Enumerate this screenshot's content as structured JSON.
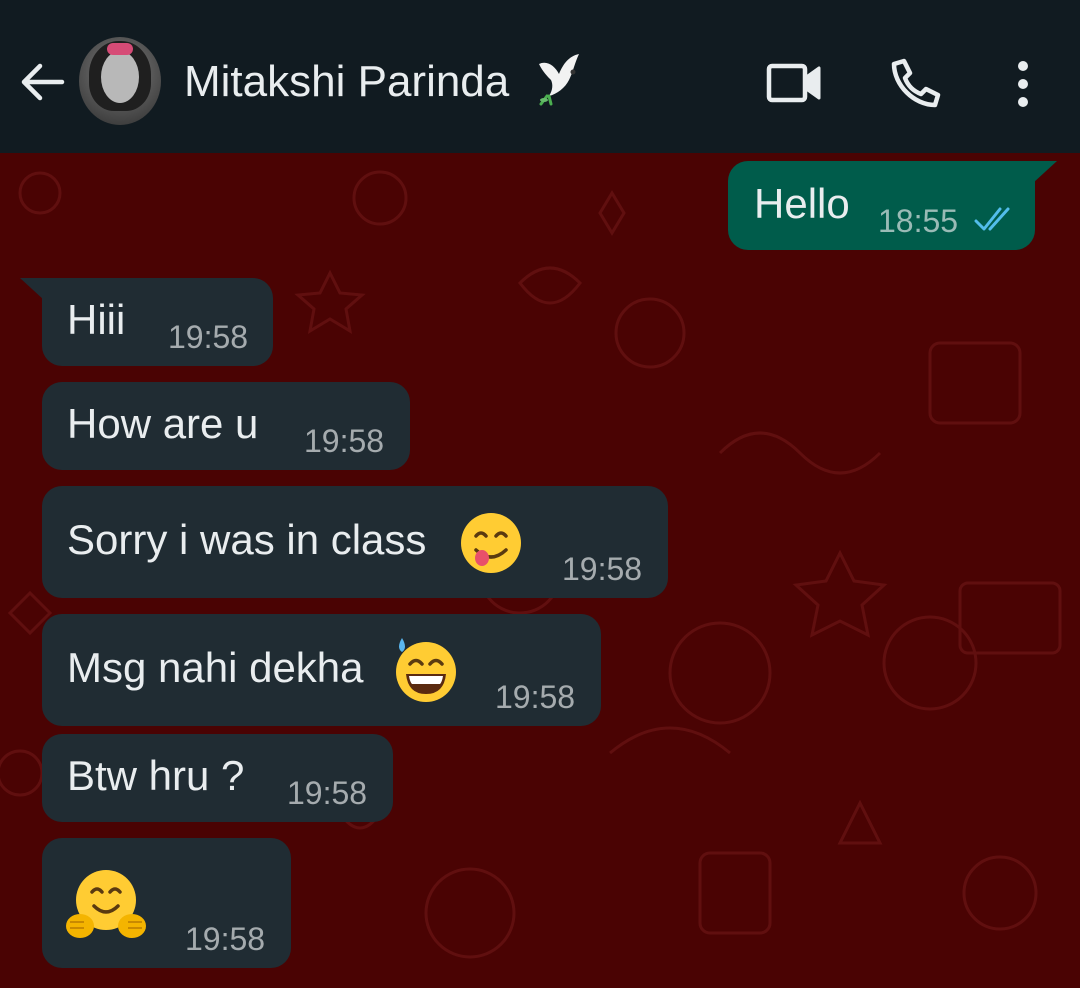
{
  "header": {
    "contact_name": "Mitakshi Parinda",
    "icons": {
      "back": "arrow-back-icon",
      "avatar": "profile-photo",
      "status_emoji": "dove-icon",
      "video": "video-camera-icon",
      "call": "phone-icon",
      "menu": "more-vertical-icon"
    }
  },
  "colors": {
    "header_bg": "#111b21",
    "wallpaper": "#4a0303",
    "incoming_bubble": "#202c33",
    "outgoing_bubble": "#005c4b",
    "read_ticks": "#53bdeb",
    "text": "#e9edef"
  },
  "messages": [
    {
      "direction": "outgoing",
      "text": "Hello",
      "time": "18:55",
      "status": "read"
    },
    {
      "direction": "incoming",
      "text": "Hiii",
      "time": "19:58"
    },
    {
      "direction": "incoming",
      "text": "How are u",
      "time": "19:58"
    },
    {
      "direction": "incoming",
      "text": "Sorry i was in class",
      "emoji": "face-savoring-food-emoji",
      "time": "19:58"
    },
    {
      "direction": "incoming",
      "text": "Msg nahi dekha",
      "emoji": "grinning-sweat-emoji",
      "time": "19:58"
    },
    {
      "direction": "incoming",
      "text": "Btw hru ?",
      "time": "19:58"
    },
    {
      "direction": "incoming",
      "text": "",
      "emoji": "hugging-face-emoji",
      "time": "19:58"
    }
  ]
}
